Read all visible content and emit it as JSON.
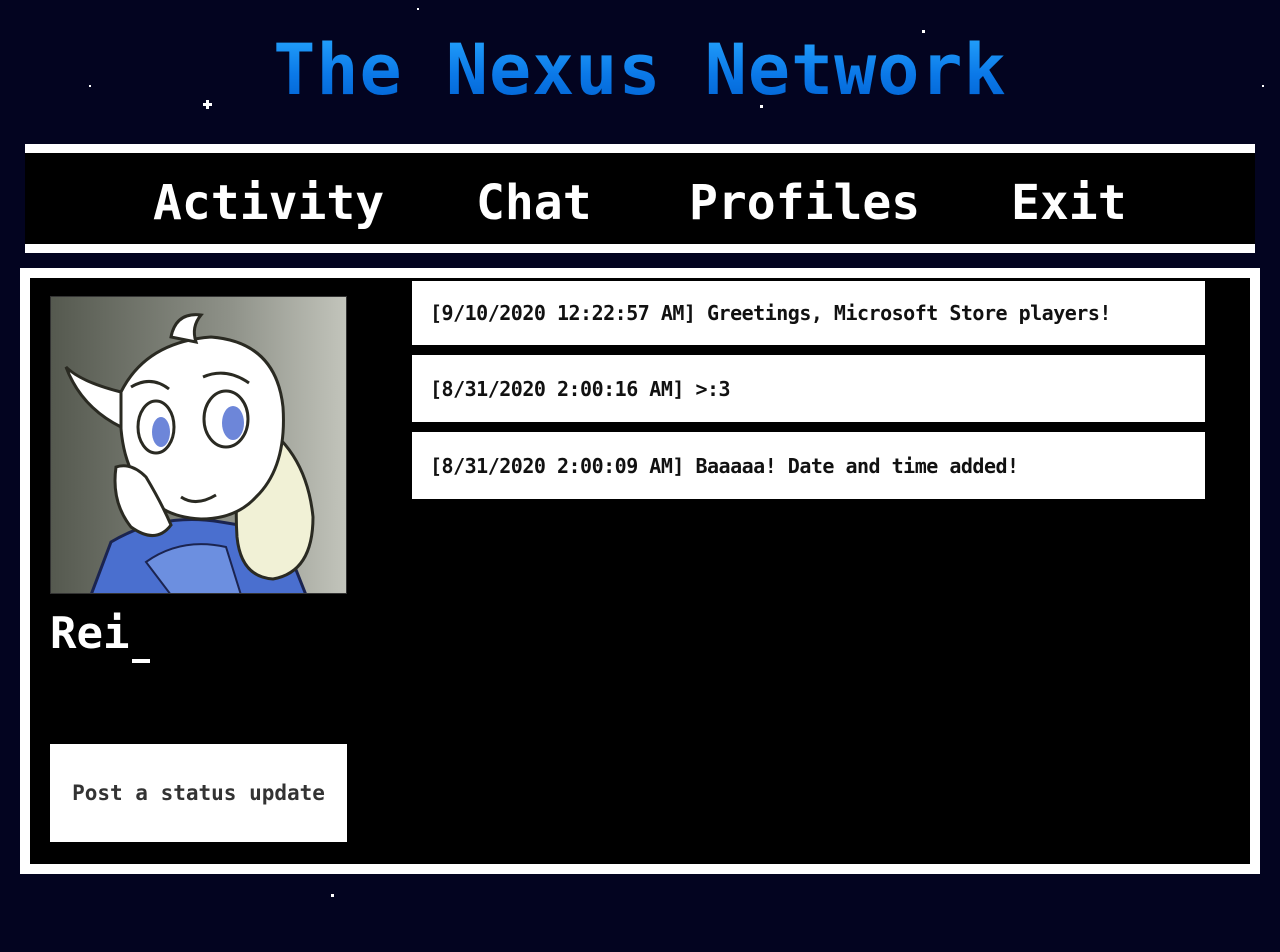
{
  "site": {
    "title": "The Nexus Network",
    "title_color": "#0b79e8",
    "background_color": "#030420"
  },
  "nav": {
    "items": [
      {
        "label": "Activity"
      },
      {
        "label": "Chat"
      },
      {
        "label": "Profiles"
      },
      {
        "label": "Exit"
      }
    ]
  },
  "profile": {
    "name": "Rei",
    "avatar_icon": "goat-character-avatar",
    "status_button_label": "Post a status update"
  },
  "feed": {
    "items": [
      {
        "text": "[9/10/2020 12:22:57 AM] Greetings, Microsoft Store players!"
      },
      {
        "text": "[8/31/2020 2:00:16 AM] >:3"
      },
      {
        "text": "[8/31/2020 2:00:09 AM] Baaaaa! Date and time added!"
      }
    ]
  }
}
